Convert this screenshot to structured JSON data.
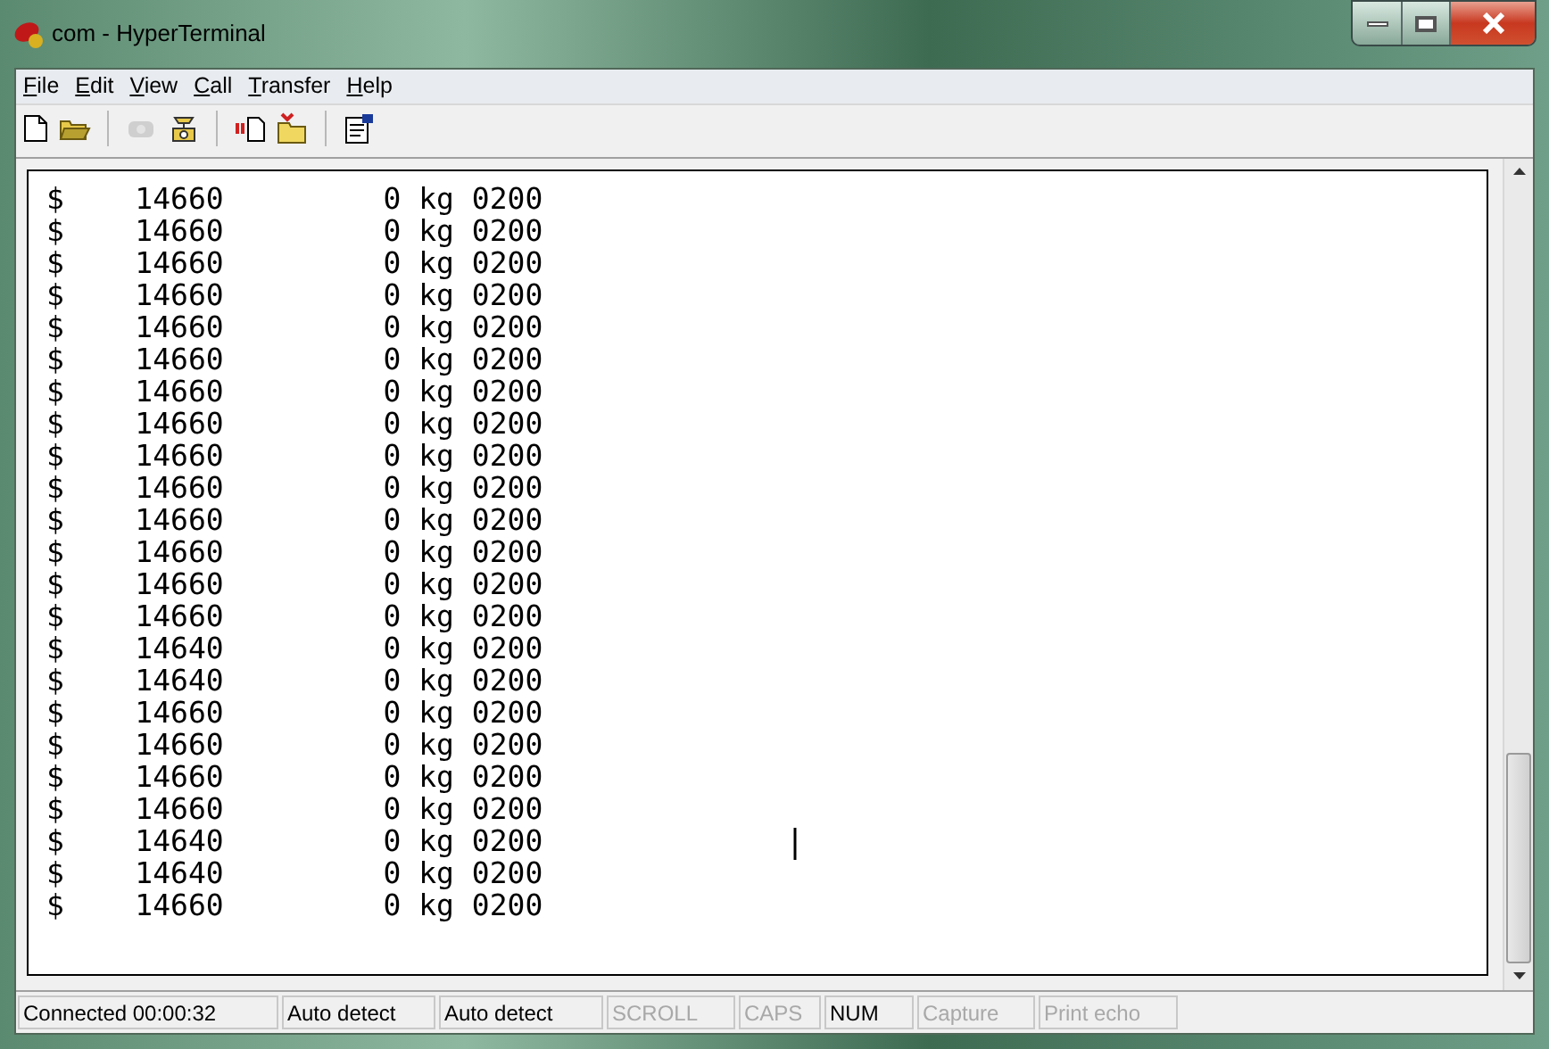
{
  "window": {
    "title": "com - HyperTerminal"
  },
  "menu": [
    {
      "label": "F",
      "rest": "ile"
    },
    {
      "label": "E",
      "rest": "dit"
    },
    {
      "label": "V",
      "rest": "iew"
    },
    {
      "label": "C",
      "rest": "all"
    },
    {
      "label": "T",
      "rest": "ransfer"
    },
    {
      "label": "H",
      "rest": "elp"
    }
  ],
  "toolbar": [
    {
      "kind": "new",
      "disabled": false
    },
    {
      "kind": "open",
      "disabled": false
    },
    {
      "kind": "sep"
    },
    {
      "kind": "disconnect",
      "disabled": true
    },
    {
      "kind": "dial",
      "disabled": false
    },
    {
      "kind": "sep"
    },
    {
      "kind": "send",
      "disabled": false
    },
    {
      "kind": "receive",
      "disabled": false
    },
    {
      "kind": "sep"
    },
    {
      "kind": "properties",
      "disabled": false
    }
  ],
  "terminal": {
    "lines": [
      "$    14660         0 kg 0200",
      "$    14660         0 kg 0200",
      "$    14660         0 kg 0200",
      "$    14660         0 kg 0200",
      "$    14660         0 kg 0200",
      "$    14660         0 kg 0200",
      "$    14660         0 kg 0200",
      "$    14660         0 kg 0200",
      "$    14660         0 kg 0200",
      "$    14660         0 kg 0200",
      "$    14660         0 kg 0200",
      "$    14660         0 kg 0200",
      "$    14660         0 kg 0200",
      "$    14660         0 kg 0200",
      "$    14640         0 kg 0200",
      "$    14640         0 kg 0200",
      "$    14660         0 kg 0200",
      "$    14660         0 kg 0200",
      "$    14660         0 kg 0200",
      "$    14660         0 kg 0200",
      "$    14640         0 kg 0200",
      "$    14640         0 kg 0200",
      "$    14660         0 kg 0200"
    ]
  },
  "status_bar": [
    {
      "text": "Connected 00:00:32",
      "active": true
    },
    {
      "text": "Auto detect",
      "active": true
    },
    {
      "text": "Auto detect",
      "active": true
    },
    {
      "text": "SCROLL",
      "active": false
    },
    {
      "text": "CAPS",
      "active": false
    },
    {
      "text": "NUM",
      "active": true
    },
    {
      "text": "Capture",
      "active": false
    },
    {
      "text": "Print echo",
      "active": false
    }
  ]
}
